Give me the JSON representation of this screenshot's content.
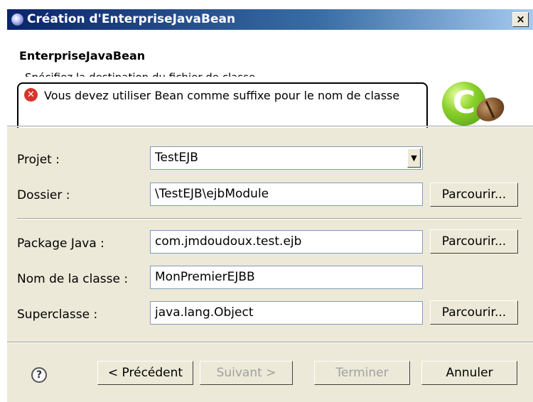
{
  "window": {
    "title": "Création d'EnterpriseJavaBean",
    "close_label": "×"
  },
  "header": {
    "title": "EnterpriseJavaBean",
    "description": "Spécifiez la destination du fichier de classe",
    "error_message": "Vous devez utiliser Bean comme suffixe pour le nom de classe"
  },
  "form": {
    "projet_label": "Projet :",
    "projet_value": "TestEJB",
    "dossier_label": "Dossier :",
    "dossier_value": "\\TestEJB\\ejbModule",
    "package_label": "Package Java :",
    "package_value": "com.jmdoudoux.test.ejb",
    "classe_label": "Nom de la classe :",
    "classe_value": "MonPremierEJBB",
    "superclasse_label": "Superclasse :",
    "superclasse_value": "java.lang.Object",
    "browse_label": "Parcourir..."
  },
  "buttons": {
    "help": "?",
    "previous": "< Précédent",
    "next": "Suivant >",
    "finish": "Terminer",
    "cancel": "Annuler"
  }
}
